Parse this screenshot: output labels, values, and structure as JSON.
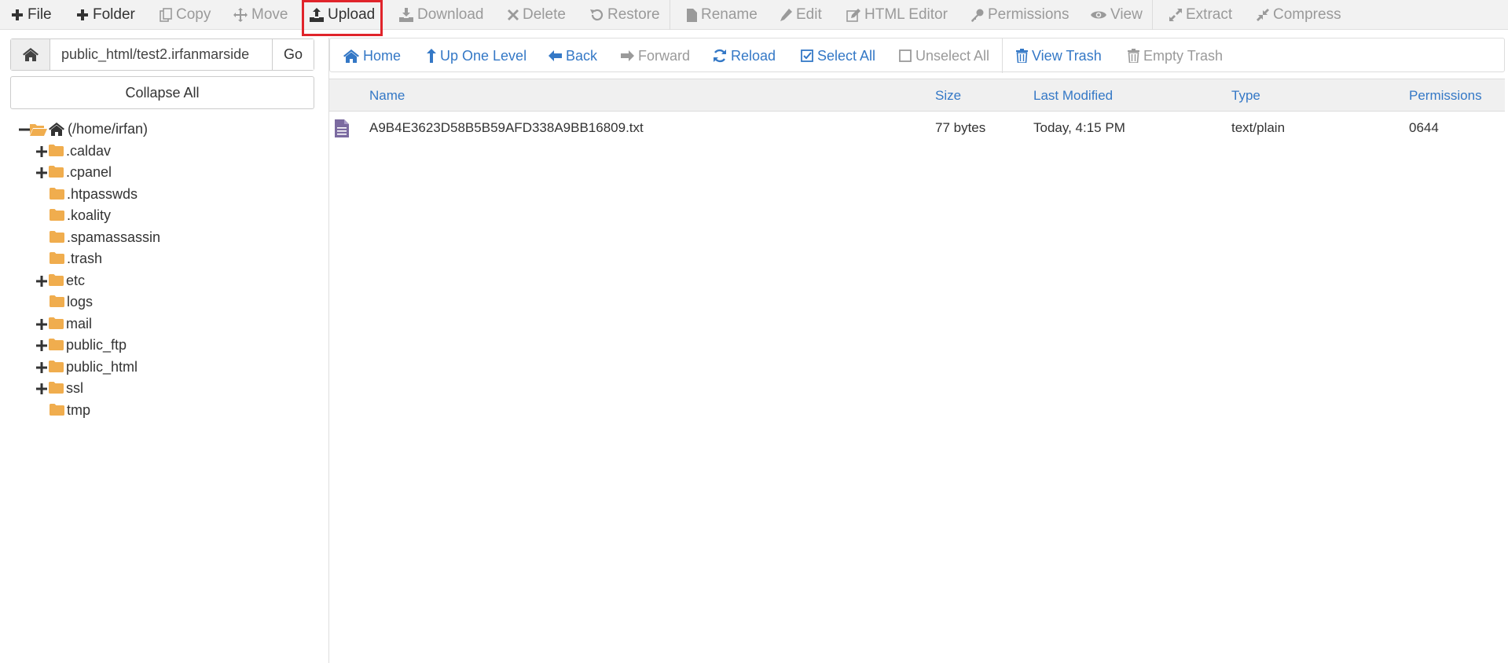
{
  "toolbar": {
    "file": "File",
    "folder": "Folder",
    "copy": "Copy",
    "move": "Move",
    "upload": "Upload",
    "download": "Download",
    "delete": "Delete",
    "restore": "Restore",
    "rename": "Rename",
    "edit": "Edit",
    "html_editor": "HTML Editor",
    "permissions": "Permissions",
    "view": "View",
    "extract": "Extract",
    "compress": "Compress"
  },
  "path_bar": {
    "value": "public_html/test2.irfanmarside",
    "go_label": "Go"
  },
  "collapse_all": "Collapse All",
  "tree": {
    "root_label": "(/home/irfan)",
    "items": [
      {
        "label": ".caldav",
        "expandable": true
      },
      {
        "label": ".cpanel",
        "expandable": true
      },
      {
        "label": ".htpasswds",
        "expandable": false
      },
      {
        "label": ".koality",
        "expandable": false
      },
      {
        "label": ".spamassassin",
        "expandable": false
      },
      {
        "label": ".trash",
        "expandable": false
      },
      {
        "label": "etc",
        "expandable": true
      },
      {
        "label": "logs",
        "expandable": false
      },
      {
        "label": "mail",
        "expandable": true
      },
      {
        "label": "public_ftp",
        "expandable": true
      },
      {
        "label": "public_html",
        "expandable": true
      },
      {
        "label": "ssl",
        "expandable": true
      },
      {
        "label": "tmp",
        "expandable": false
      }
    ]
  },
  "nav": {
    "home": "Home",
    "up_one_level": "Up One Level",
    "back": "Back",
    "forward": "Forward",
    "reload": "Reload",
    "select_all": "Select All",
    "unselect_all": "Unselect All",
    "view_trash": "View Trash",
    "empty_trash": "Empty Trash"
  },
  "table": {
    "headers": {
      "name": "Name",
      "size": "Size",
      "last_modified": "Last Modified",
      "type": "Type",
      "permissions": "Permissions"
    },
    "rows": [
      {
        "name": "A9B4E3623D58B5B59AFD338A9BB16809.txt",
        "size": "77 bytes",
        "last_modified": "Today, 4:15 PM",
        "type": "text/plain",
        "permissions": "0644"
      }
    ]
  },
  "colors": {
    "link_blue": "#3478c6",
    "folder_orange": "#f0ad4e",
    "highlight_red": "#e0242b",
    "file_icon_purple": "#7b6aa0"
  }
}
